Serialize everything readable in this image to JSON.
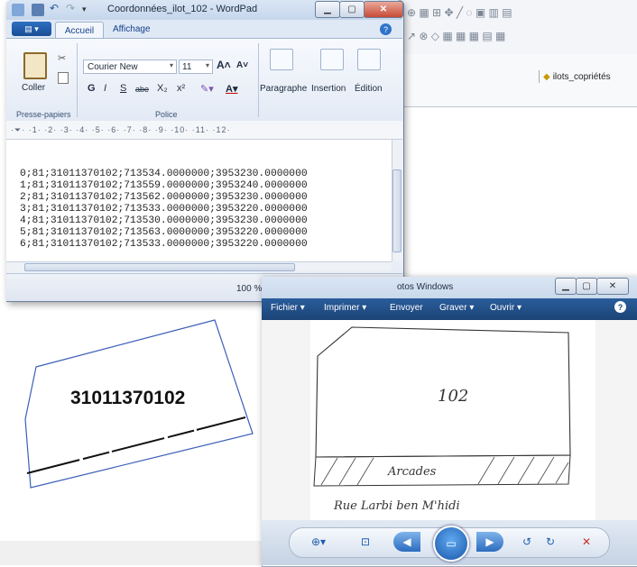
{
  "background_app": {
    "layer_name": "ilots_copriétés"
  },
  "parcel_map": {
    "parcel_id": "31011370102"
  },
  "wordpad": {
    "title": "Coordonnées_ilot_102 - WordPad",
    "menu_button": "▤ ▾",
    "tabs": [
      "Accueil",
      "Affichage"
    ],
    "clipboard": {
      "paste": "Coller",
      "group": "Presse-papiers"
    },
    "font": {
      "family": "Courier New",
      "size": "11",
      "group": "Police",
      "buttons": [
        "G",
        "I",
        "S",
        "abe",
        "X₂",
        "x²"
      ]
    },
    "paragraph": "Paragraphe",
    "insertion": "Insertion",
    "edition": "Édition",
    "ruler": "·⏷· ·1· ·2· ·3· ·4· ·5· ·6· ·7· ·8· ·9· ·10· ·11· ·12·",
    "lines": [
      "0;81;31011370102;713534.0000000;3953230.0000000",
      "1;81;31011370102;713559.0000000;3953240.0000000",
      "2;81;31011370102;713562.0000000;3953230.0000000",
      "3;81;31011370102;713533.0000000;3953220.0000000",
      "4;81;31011370102;713530.0000000;3953230.0000000",
      "5;81;31011370102;713563.0000000;3953220.0000000",
      "6;81;31011370102;713533.0000000;3953220.0000000"
    ],
    "zoom": "100 %"
  },
  "photo_viewer": {
    "title_partial": "otos Windows",
    "menu": [
      "Fichier ▾",
      "Imprimer ▾",
      "Envoyer",
      "Graver ▾",
      "Ouvrir ▾"
    ],
    "sketch": {
      "number": "102",
      "band_label": "Arcades",
      "street": "Rue Larbi ben M'hidi"
    }
  },
  "colors": {
    "ribbon_blue": "#15428b",
    "viewer_menu": "#1c4376",
    "close_red": "#c74a36"
  }
}
